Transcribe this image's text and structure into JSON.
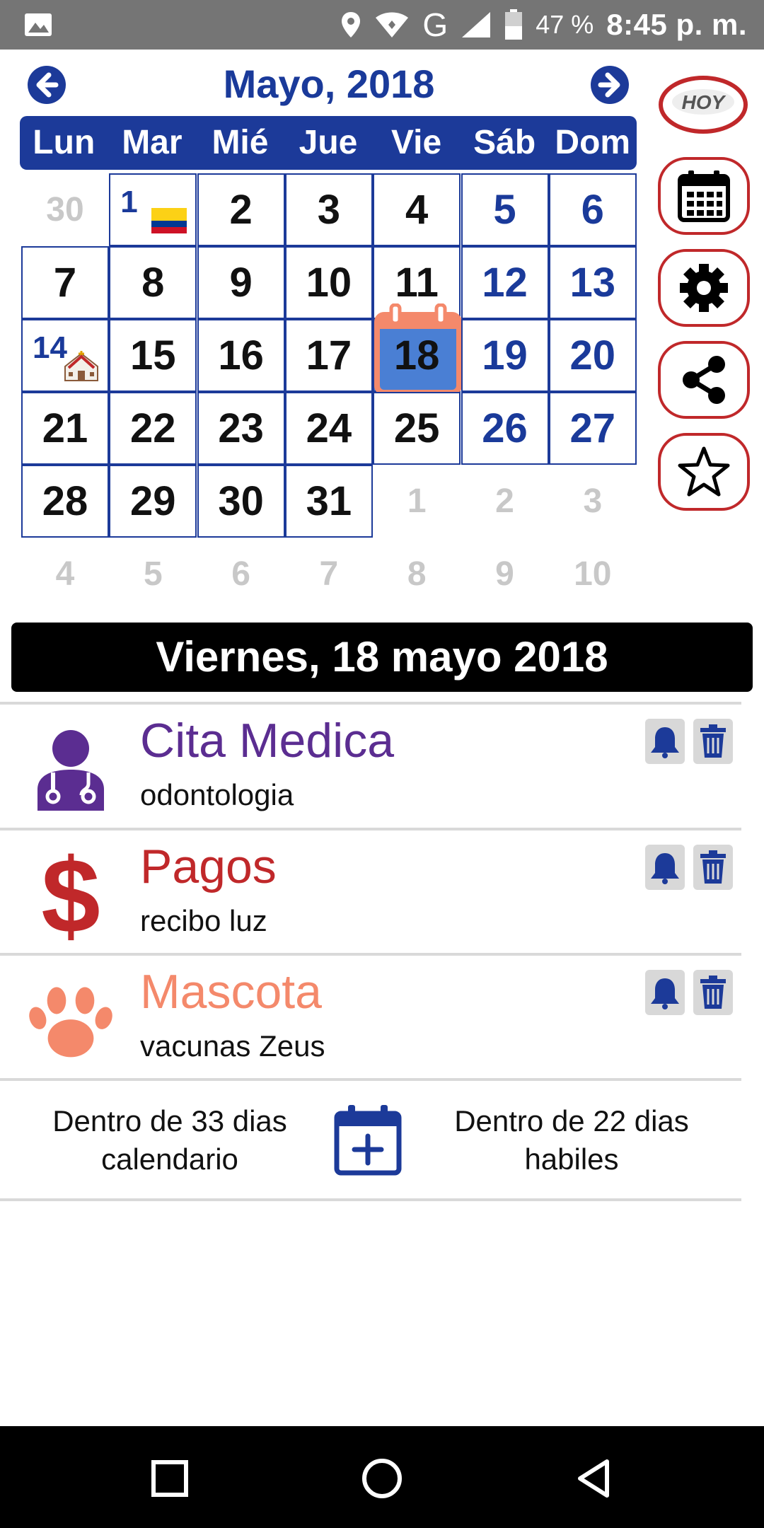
{
  "status_bar": {
    "battery": "47 %",
    "time": "8:45 p. m.",
    "network": "G"
  },
  "calendar": {
    "title": "Mayo, 2018",
    "weekdays": [
      "Lun",
      "Mar",
      "Mié",
      "Jue",
      "Vie",
      "Sáb",
      "Dom"
    ],
    "rows": [
      [
        "30",
        "1",
        "2",
        "3",
        "4",
        "5",
        "6"
      ],
      [
        "7",
        "8",
        "9",
        "10",
        "11",
        "12",
        "13"
      ],
      [
        "14",
        "15",
        "16",
        "17",
        "18",
        "19",
        "20"
      ],
      [
        "21",
        "22",
        "23",
        "24",
        "25",
        "26",
        "27"
      ],
      [
        "28",
        "29",
        "30",
        "31",
        "1",
        "2",
        "3"
      ],
      [
        "4",
        "5",
        "6",
        "7",
        "8",
        "9",
        "10"
      ]
    ],
    "today": "18",
    "holiday_badges": {
      "1": "colombia-flag-icon",
      "14": "church-icon"
    }
  },
  "side_buttons": {
    "today_label": "HOY"
  },
  "selected_date": "Viernes, 18 mayo 2018",
  "events": [
    {
      "title": "Cita Medica",
      "subtitle": "odontologia",
      "color": "#5b2d91",
      "icon": "doctor-icon"
    },
    {
      "title": "Pagos",
      "subtitle": "recibo luz",
      "color": "#c0282a",
      "icon": "dollar-icon"
    },
    {
      "title": "Mascota",
      "subtitle": "vacunas Zeus",
      "color": "#f4896b",
      "icon": "paw-icon"
    }
  ],
  "counters": {
    "calendar_line1": "Dentro de 33 dias",
    "calendar_line2": "calendario",
    "business_line1": "Dentro de 22 dias",
    "business_line2": "habiles"
  },
  "colors": {
    "primary": "#1c3a99",
    "accent_red": "#c0282a",
    "today_bg": "#4a7fd4",
    "today_frame": "#f4896b"
  }
}
